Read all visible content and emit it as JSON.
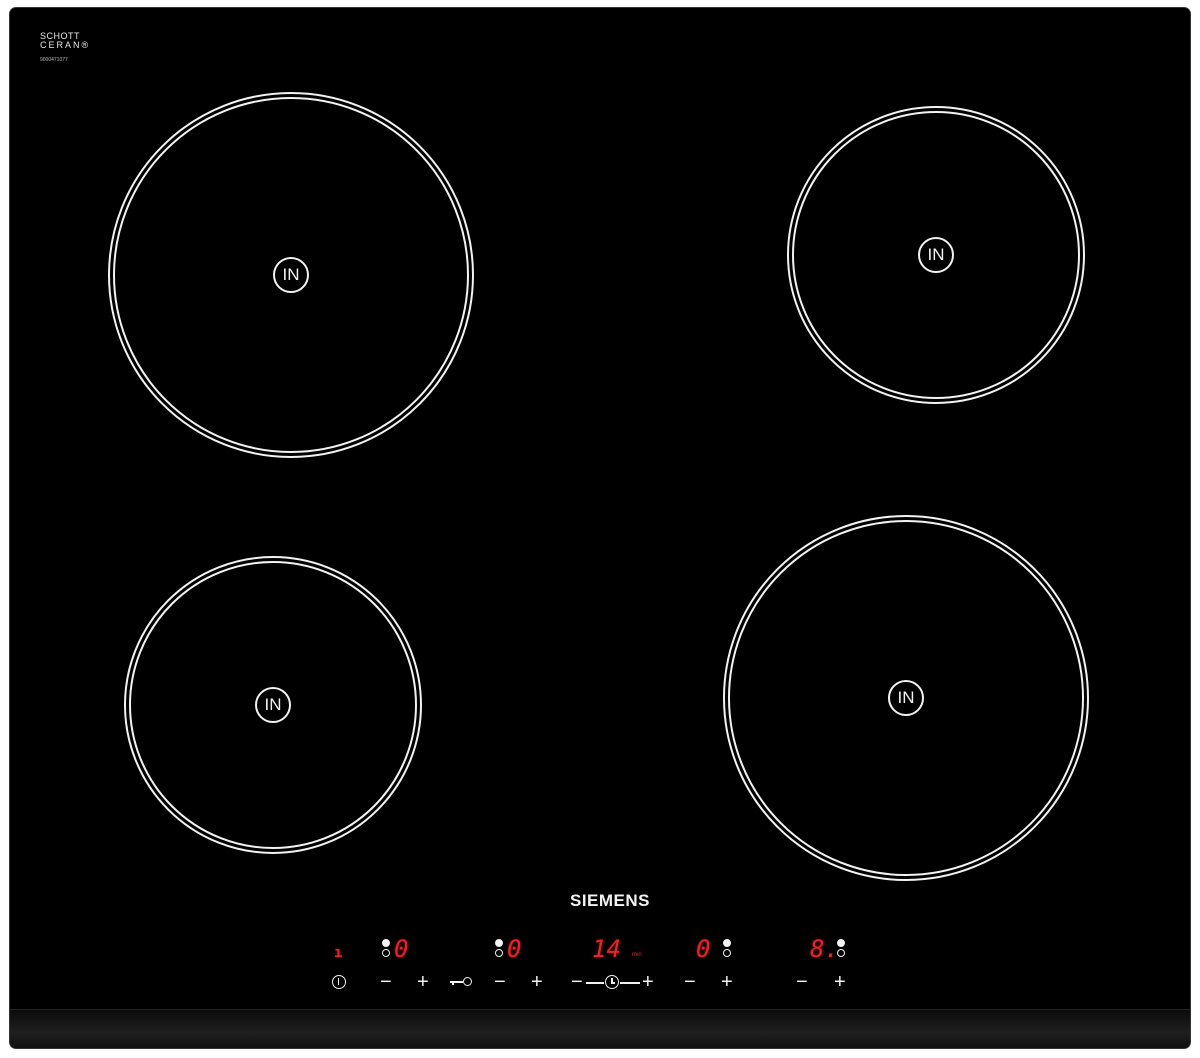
{
  "logo": {
    "line1": "SCHOTT",
    "line2": "CERAN®",
    "serial": "9000471077"
  },
  "zones": [
    {
      "name": "front-left-top",
      "label": "IN"
    },
    {
      "name": "rear-right",
      "label": "IN"
    },
    {
      "name": "front-left",
      "label": "IN"
    },
    {
      "name": "front-right",
      "label": "IN"
    }
  ],
  "brand": "SIEMENS",
  "displays": {
    "main_indicator": "ı",
    "zone1_level": "0",
    "zone2_level": "0",
    "timer_value": "14",
    "timer_unit": "min",
    "zone3_level": "0",
    "zone4_level": "8."
  },
  "controls": {
    "minus": "−",
    "plus": "+"
  },
  "colors": {
    "panel": "#000000",
    "print": "#f2f2f2",
    "display": "#e0262a"
  },
  "icons": [
    "power-icon",
    "child-lock-icon",
    "timer-icon",
    "zone-indicator-dots-icon"
  ]
}
